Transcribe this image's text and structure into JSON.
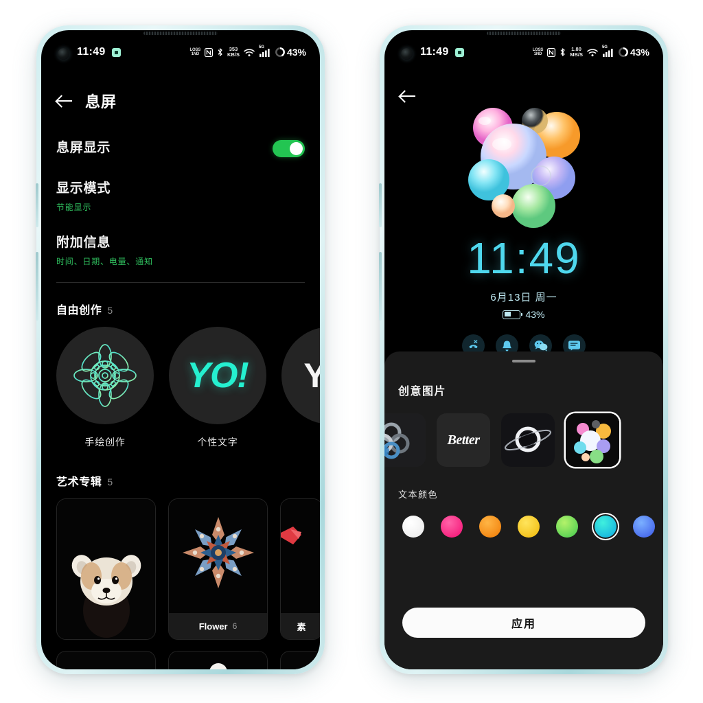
{
  "colors": {
    "frame": "#cfeef0",
    "accent_green": "#23c552",
    "accent_cyan": "#4fd8ee",
    "sheet_bg": "#1b1b1b",
    "screen_bg": "#000000"
  },
  "left_phone": {
    "status_bar": {
      "time": "11:49",
      "net_line1": "LOSS",
      "net_line2": "1ND",
      "rate_value": "353",
      "rate_unit": "KB/S",
      "nfc_label": "N",
      "signal_label": "5G",
      "battery_percent": "43%"
    },
    "app_bar": {
      "title": "息屏",
      "back_icon": "back-arrow-icon"
    },
    "settings_rows": [
      {
        "title": "息屏显示",
        "subtitle": "",
        "has_toggle": true,
        "toggle_on": true
      },
      {
        "title": "显示模式",
        "subtitle": "节能显示",
        "has_toggle": false,
        "toggle_on": false
      },
      {
        "title": "附加信息",
        "subtitle": "时间、日期、电量、通知",
        "has_toggle": false,
        "toggle_on": false
      }
    ],
    "free_creation": {
      "title": "自由创作",
      "count": "5",
      "items": [
        {
          "label": "手绘创作",
          "icon": "mandala-drawing-icon"
        },
        {
          "label": "个性文字",
          "icon": "yo-text-icon",
          "text": "YO!"
        },
        {
          "label": "",
          "icon": "partial-letter-icon"
        }
      ]
    },
    "art_album": {
      "title": "艺术专辑",
      "count": "5",
      "cards": [
        {
          "name": "",
          "count": "",
          "icon": "red-panda-photo"
        },
        {
          "name": "Flower",
          "count": "6",
          "icon": "flower-mandala-photo"
        },
        {
          "name": "素",
          "count": "",
          "icon": "red-shape-photo"
        }
      ],
      "cards_row2": [
        {
          "name": "",
          "count": "",
          "icon": "moon-photo"
        },
        {
          "name": "",
          "count": "",
          "icon": "partial-photo"
        }
      ]
    }
  },
  "right_phone": {
    "status_bar": {
      "time": "11:49",
      "net_line1": "LOSS",
      "net_line2": "1ND",
      "rate_value": "1.80",
      "rate_unit": "MB/S",
      "nfc_label": "N",
      "signal_label": "5G",
      "battery_percent": "43%"
    },
    "back_icon": "back-arrow-icon",
    "aod_preview": {
      "artwork": "colorful-bubbles-cluster",
      "clock": "11:49",
      "date": "6月13日 周一",
      "battery_percent": "43%",
      "notifications": [
        {
          "icon": "missed-call-icon"
        },
        {
          "icon": "alarm-bell-icon"
        },
        {
          "icon": "wechat-icon"
        },
        {
          "icon": "message-icon"
        }
      ]
    },
    "sheet": {
      "handle": "drag-handle",
      "title": "创意图片",
      "thumbnails": [
        {
          "icon": "metal-rings-thumb",
          "selected": false
        },
        {
          "icon": "better-text-thumb",
          "label": "Better",
          "selected": false
        },
        {
          "icon": "black-hole-thumb",
          "selected": false
        },
        {
          "icon": "colorful-bubbles-thumb",
          "selected": true
        }
      ],
      "colors_title": "文本颜色",
      "swatches": [
        {
          "name": "white",
          "hex": "#fdfdfd",
          "selected": false
        },
        {
          "name": "pink",
          "hex": "#f82a7f",
          "selected": false
        },
        {
          "name": "orange",
          "hex": "#f58a18",
          "selected": false
        },
        {
          "name": "yellow",
          "hex": "#f2cc21",
          "selected": false
        },
        {
          "name": "green",
          "hex": "#6ce34a",
          "selected": false
        },
        {
          "name": "cyan",
          "hex": "#22c8d8",
          "selected": true
        },
        {
          "name": "blue",
          "hex": "#4e7ef0",
          "selected": false
        }
      ],
      "apply_label": "应用"
    }
  }
}
